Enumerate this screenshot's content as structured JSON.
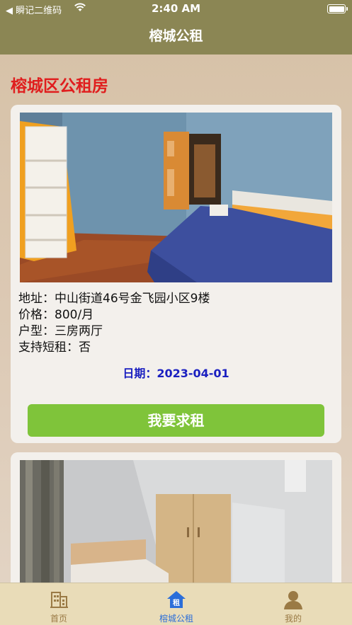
{
  "status_bar": {
    "back_app": "◀ 瞬记二维码",
    "time": "2:40 AM"
  },
  "nav": {
    "title": "榕城公租"
  },
  "section": {
    "title": "榕城区公租房"
  },
  "listings": [
    {
      "image": "bedroom-photo-blue-walls",
      "address": "地址：中山街道46号金飞园小区9楼",
      "price": "价格：800/月",
      "layout": "户型：三房两厅",
      "short_term": "支持短租：否",
      "date": "日期：2023-04-01",
      "button_label": "我要求租"
    },
    {
      "image": "bedroom-photo-wardrobe"
    }
  ],
  "tabbar": {
    "items": [
      {
        "label": "首页",
        "icon": "building-icon"
      },
      {
        "label": "榕城公租",
        "icon": "home-rent-icon"
      },
      {
        "label": "我的",
        "icon": "user-icon"
      }
    ]
  },
  "colors": {
    "header": "#8b8654",
    "section_title": "#e01e1e",
    "date_text": "#1a1fc0",
    "button": "#7fc43a",
    "tab_active": "#2b6ed9"
  }
}
